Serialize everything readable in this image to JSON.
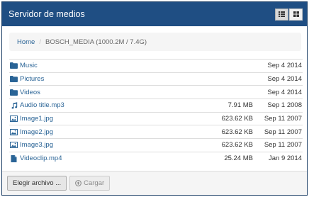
{
  "header": {
    "title": "Servidor de medios",
    "view_buttons": [
      {
        "icon": "list-view-icon",
        "active": true
      },
      {
        "icon": "grid-view-icon",
        "active": false
      }
    ]
  },
  "breadcrumb": {
    "home": "Home",
    "separator": "/",
    "current": "BOSCH_MEDIA (1000.2M / 7.4G)"
  },
  "files": [
    {
      "name": "Music",
      "size": "",
      "date": "Sep 4 2014",
      "icon": "folder-icon"
    },
    {
      "name": "Pictures",
      "size": "",
      "date": "Sep 4 2014",
      "icon": "folder-icon"
    },
    {
      "name": "Videos",
      "size": "",
      "date": "Sep 4 2014",
      "icon": "folder-icon"
    },
    {
      "name": "Audio title.mp3",
      "size": "7.91 MB",
      "date": "Sep 1 2008",
      "icon": "music-note-icon"
    },
    {
      "name": "Image1.jpg",
      "size": "623.62 KB",
      "date": "Sep 11 2007",
      "icon": "image-icon"
    },
    {
      "name": "Image2.jpg",
      "size": "623.62 KB",
      "date": "Sep 11 2007",
      "icon": "image-icon"
    },
    {
      "name": "Image3.jpg",
      "size": "623.62 KB",
      "date": "Sep 11 2007",
      "icon": "image-icon"
    },
    {
      "name": "Videoclip.mp4",
      "size": "25.24 MB",
      "date": "Jan 9 2014",
      "icon": "file-icon"
    }
  ],
  "footer": {
    "choose_label": "Elegir archivo ...",
    "upload_label": "Cargar"
  },
  "colors": {
    "header_bg": "#1f4e83",
    "link": "#2a6496"
  }
}
